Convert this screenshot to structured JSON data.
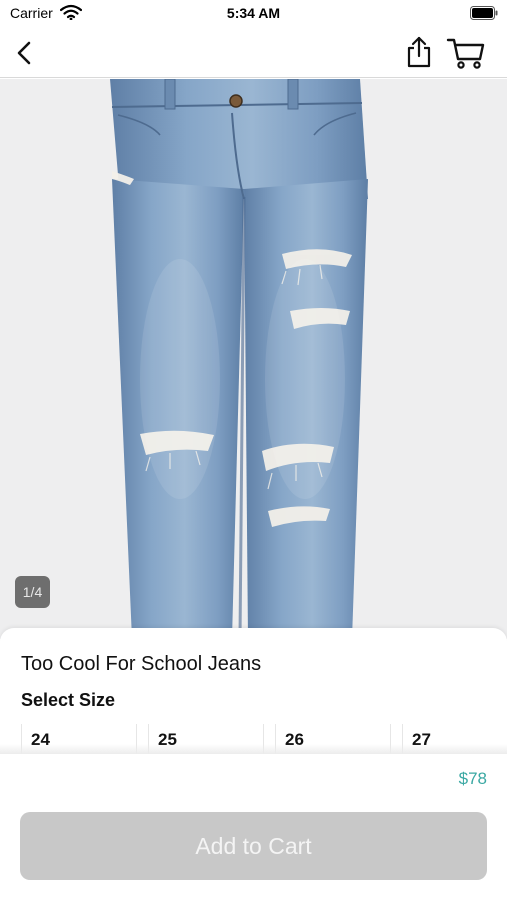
{
  "status_bar": {
    "carrier": "Carrier",
    "time": "5:34 AM"
  },
  "nav": {
    "back_icon": "chevron-left-icon",
    "share_icon": "share-icon",
    "cart_icon": "cart-icon"
  },
  "gallery": {
    "counter": "1/4"
  },
  "product": {
    "title": "Too Cool For School Jeans",
    "size_label": "Select Size",
    "sizes": [
      "24",
      "25",
      "26",
      "27"
    ],
    "price": "$78",
    "add_to_cart_label": "Add to Cart"
  },
  "colors": {
    "price": "#3aa8a3",
    "button_disabled": "#c8c8c8",
    "denim": "#7f9ec0"
  }
}
